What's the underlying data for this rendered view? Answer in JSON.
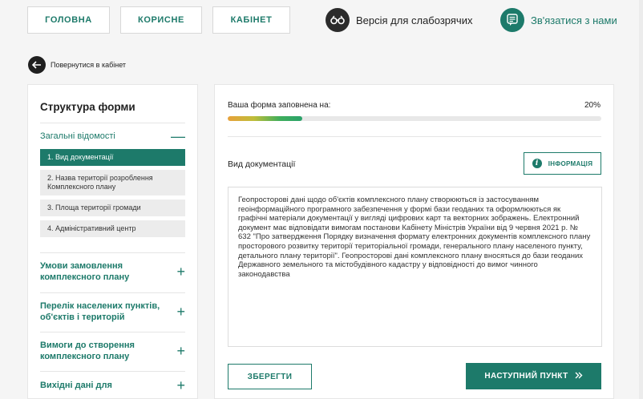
{
  "nav": {
    "home": "ГОЛОВНА",
    "useful": "КОРИСНЕ",
    "cabinet": "КАБІНЕТ",
    "accessibility": "Версія для слабозрячих",
    "contact": "Зв'язатися з нами"
  },
  "back_label": "Повернутися в кабінет",
  "sidebar": {
    "title": "Структура форми",
    "sections": [
      {
        "label": "Загальні відомості",
        "toggle": "—",
        "items": [
          "1. Вид документації",
          "2. Назва території розроблення Комплексного плану",
          "3. Площа території громади",
          "4. Адміністративний центр"
        ]
      },
      {
        "label": "Умови замовлення комплексного плану",
        "toggle": "+"
      },
      {
        "label": "Перелік населених пунктів, об'єктів і територій",
        "toggle": "+"
      },
      {
        "label": "Вимоги до створення комплексного плану",
        "toggle": "+"
      },
      {
        "label": "Вихідні дані для",
        "toggle": "+"
      }
    ]
  },
  "form": {
    "progress_label": "Ваша форма заповнена на:",
    "progress_text": "20%",
    "progress_value": 0.2,
    "field_label": "Вид документації",
    "info_button": "ІНФОРМАЦІЯ",
    "text": "Геопросторові дані щодо об'єктів комплексного плану створюються із застосуванням геоінформаційного програмного забезпечення у формі бази геоданих та оформлюються як графічні матеріали документації у вигляді цифрових карт та векторних зображень. Електронний документ має відповідати вимогам постанови Кабінету Міністрів України від 9 червня 2021 р. № 632 \"Про затвердження Порядку визначення формату електронних документів комплексного плану просторового розвитку території територіальної громади, генерального плану населеного пункту, детального плану території\". Геопросторові дані комплексного плану вносяться до бази геоданих Державного земельного та містобудівного кадастру у відповідності до вимог чинного законодавства",
    "save_button": "ЗБЕРЕГТИ",
    "next_button": "НАСТУПНИЙ ПУНКТ"
  },
  "icons": {
    "accessibility": "glasses-icon",
    "contact": "message-icon",
    "back": "arrow-left-icon",
    "info": "info-icon",
    "next": "double-chevron-right-icon"
  },
  "colors": {
    "accent": "#1d7a6a",
    "dark": "#2b2b2b"
  }
}
